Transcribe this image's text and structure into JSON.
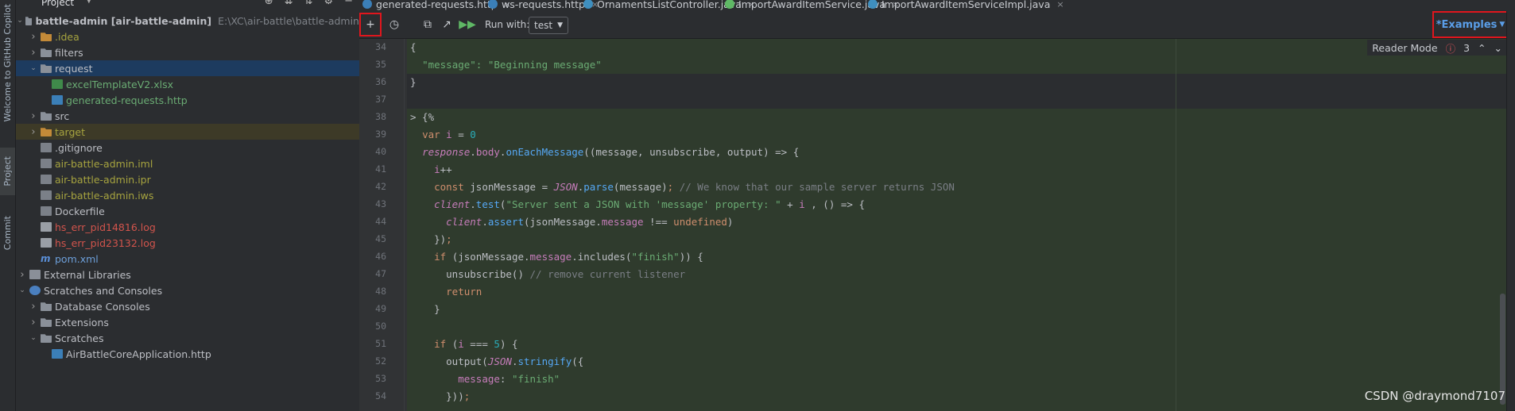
{
  "left_strip": {
    "tabs": [
      {
        "label": "Welcome to GitHub Copilot"
      },
      {
        "label": "Project"
      },
      {
        "label": "Commit"
      }
    ]
  },
  "project_panel": {
    "title": "Project",
    "tree": [
      {
        "label": "battle-admin [air-battle-admin]",
        "suffix": "E:\\XC\\air-battle\\battle-admin",
        "depth": 0,
        "expanded": true,
        "icon": "folder",
        "color": "grey"
      },
      {
        "label": ".idea",
        "depth": 1,
        "expanded": false,
        "icon": "folder",
        "color": "olive"
      },
      {
        "label": "filters",
        "depth": 1,
        "expanded": false,
        "icon": "folder",
        "color": "grey"
      },
      {
        "label": "request",
        "depth": 1,
        "expanded": true,
        "icon": "folder",
        "color": "grey",
        "selected": true
      },
      {
        "label": "excelTemplateV2.xlsx",
        "depth": 2,
        "icon": "file-x",
        "color": "green"
      },
      {
        "label": "generated-requests.http",
        "depth": 2,
        "icon": "file-http",
        "color": "green"
      },
      {
        "label": "src",
        "depth": 1,
        "expanded": false,
        "icon": "folder",
        "color": "grey"
      },
      {
        "label": "target",
        "depth": 1,
        "expanded": false,
        "icon": "folder-orange",
        "color": "olive",
        "target": true
      },
      {
        "label": ".gitignore",
        "depth": 1,
        "icon": "file-txt",
        "color": "grey"
      },
      {
        "label": "air-battle-admin.iml",
        "depth": 1,
        "icon": "file-txt",
        "color": "olive"
      },
      {
        "label": "air-battle-admin.ipr",
        "depth": 1,
        "icon": "file-txt",
        "color": "olive"
      },
      {
        "label": "air-battle-admin.iws",
        "depth": 1,
        "icon": "file-txt",
        "color": "olive"
      },
      {
        "label": "Dockerfile",
        "depth": 1,
        "icon": "file-txt",
        "color": "grey"
      },
      {
        "label": "hs_err_pid14816.log",
        "depth": 1,
        "icon": "file-log",
        "color": "red"
      },
      {
        "label": "hs_err_pid23132.log",
        "depth": 1,
        "icon": "file-log",
        "color": "red"
      },
      {
        "label": "pom.xml",
        "depth": 1,
        "icon": "file-m",
        "color": "blue"
      },
      {
        "label": "External Libraries",
        "depth": 0,
        "expanded": false,
        "icon": "lib",
        "color": "grey"
      },
      {
        "label": "Scratches and Consoles",
        "depth": 0,
        "expanded": true,
        "icon": "scratch",
        "color": "grey"
      },
      {
        "label": "Database Consoles",
        "depth": 1,
        "expanded": false,
        "icon": "folder",
        "color": "grey"
      },
      {
        "label": "Extensions",
        "depth": 1,
        "expanded": false,
        "icon": "folder",
        "color": "grey"
      },
      {
        "label": "Scratches",
        "depth": 1,
        "expanded": true,
        "icon": "folder",
        "color": "grey"
      },
      {
        "label": "AirBattleCoreApplication.http",
        "depth": 2,
        "icon": "file-http",
        "color": "grey"
      }
    ]
  },
  "tabs": [
    {
      "label": "generated-requests.http",
      "icon": "http",
      "active": false
    },
    {
      "label": "ws-requests.http",
      "icon": "http",
      "active": true
    },
    {
      "label": "OrnamentsListController.java",
      "icon": "class",
      "active": false
    },
    {
      "label": "ImportAwardItemService.java",
      "icon": "interface",
      "active": false
    },
    {
      "label": "ImportAwardItemServiceImpl.java",
      "icon": "class",
      "active": false
    }
  ],
  "toolbar": {
    "add_label": "+",
    "run_with_label": "Run with:",
    "env_value": "test",
    "examples_label": "*Examples"
  },
  "reader": {
    "label": "Reader Mode",
    "errors": "3"
  },
  "watermark": "CSDN @draymond7107",
  "code_lines": [
    {
      "n": "34",
      "html": "<span class=\"pl\">{</span>"
    },
    {
      "n": "35",
      "html": "  <span class=\"s\">\"message\": \"Beginning message\"</span>"
    },
    {
      "n": "36",
      "html": "<span class=\"pl\">}</span>"
    },
    {
      "n": "37",
      "html": ""
    },
    {
      "n": "38",
      "html": "<span class=\"pl\">&gt; {%</span>"
    },
    {
      "n": "39",
      "html": "  <span class=\"k\">var</span> <span class=\"p\">i</span> = <span class=\"n\">0</span>"
    },
    {
      "n": "40",
      "html": "  <span class=\"i\">response</span>.<span class=\"p\">body</span>.<span class=\"f\">onEachMessage</span>((message, unsubscribe, output) =&gt; {"
    },
    {
      "n": "41",
      "html": "    <span class=\"p\">i</span>++"
    },
    {
      "n": "42",
      "html": "    <span class=\"k\">const</span> jsonMessage = <span class=\"i\">JSON</span>.<span class=\"f\">parse</span>(message)<span class=\"k\">;</span> <span class=\"cm\">// We know that our sample server returns JSON</span>"
    },
    {
      "n": "43",
      "html": "    <span class=\"i\">client</span>.<span class=\"f\">test</span>(<span class=\"s\">\"Server sent a JSON with 'message' property: \"</span> + <span class=\"p\">i</span> , () =&gt; {"
    },
    {
      "n": "44",
      "html": "      <span class=\"i\">client</span>.<span class=\"f\">assert</span>(jsonMessage.<span class=\"p\">message</span> !== <span class=\"k\">undefined</span>)"
    },
    {
      "n": "45",
      "html": "    })<span class=\"k\">;</span>"
    },
    {
      "n": "46",
      "html": "    <span class=\"k\">if</span> (jsonMessage.<span class=\"p\">message</span>.includes(<span class=\"s\">\"finish\"</span>)) {"
    },
    {
      "n": "47",
      "html": "      unsubscribe() <span class=\"cm\">// remove current listener</span>"
    },
    {
      "n": "48",
      "html": "      <span class=\"k\">return</span>"
    },
    {
      "n": "49",
      "html": "    }"
    },
    {
      "n": "50",
      "html": ""
    },
    {
      "n": "51",
      "html": "    <span class=\"k\">if</span> (<span class=\"p\">i</span> === <span class=\"n\">5</span>) {"
    },
    {
      "n": "52",
      "html": "      output(<span class=\"i\">JSON</span>.<span class=\"f\">stringify</span>({"
    },
    {
      "n": "53",
      "html": "        <span class=\"p\">message</span>: <span class=\"s\">\"finish\"</span>"
    },
    {
      "n": "54",
      "html": "      }))<span class=\"k\">;</span>"
    }
  ]
}
